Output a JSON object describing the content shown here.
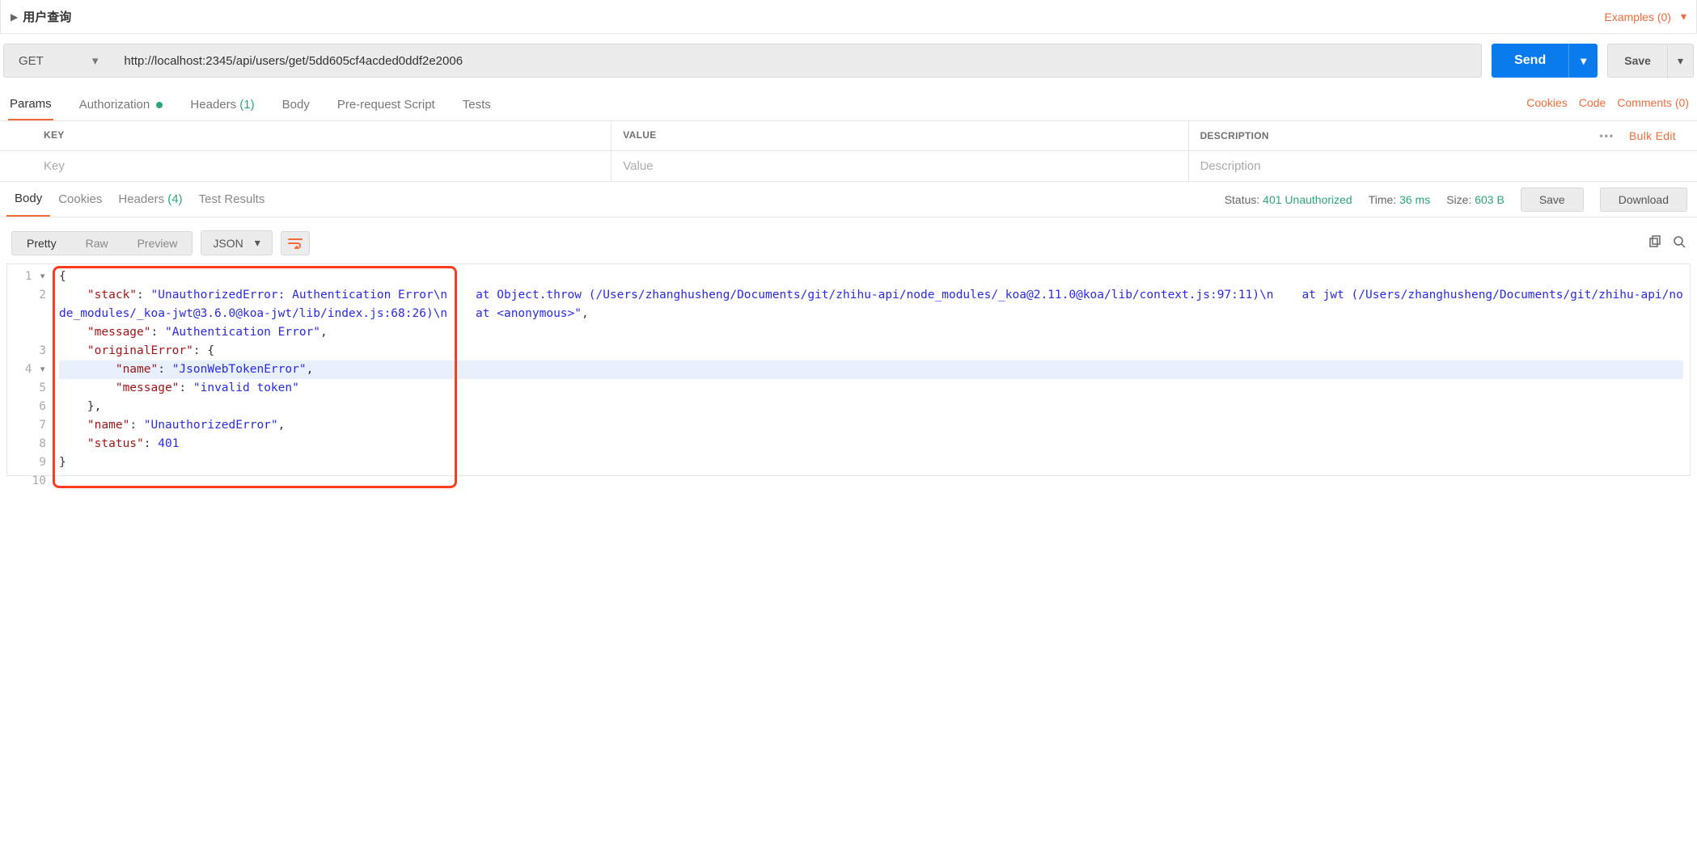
{
  "topbar": {
    "title": "用户查询",
    "examples": "Examples (0)"
  },
  "request": {
    "method": "GET",
    "url": "http://localhost:2345/api/users/get/5dd605cf4acded0ddf2e2006",
    "send": "Send",
    "save": "Save"
  },
  "reqtabs": {
    "params": "Params",
    "authorization": "Authorization",
    "headers": "Headers",
    "headers_count": "(1)",
    "body": "Body",
    "prerequest": "Pre-request Script",
    "tests": "Tests",
    "cookies": "Cookies",
    "code": "Code",
    "comments": "Comments (0)"
  },
  "params_header": {
    "key": "KEY",
    "value": "VALUE",
    "description": "DESCRIPTION",
    "bulk": "Bulk Edit"
  },
  "params_row": {
    "key_ph": "Key",
    "value_ph": "Value",
    "desc_ph": "Description"
  },
  "resp_tabs": {
    "body": "Body",
    "cookies": "Cookies",
    "headers": "Headers",
    "headers_count": "(4)",
    "tests": "Test Results"
  },
  "status": {
    "status_lbl": "Status:",
    "status_val": "401 Unauthorized",
    "time_lbl": "Time:",
    "time_val": "36 ms",
    "size_lbl": "Size:",
    "size_val": "603 B",
    "save": "Save",
    "download": "Download"
  },
  "fmt": {
    "pretty": "Pretty",
    "raw": "Raw",
    "preview": "Preview",
    "json": "JSON"
  },
  "code_lines": [
    "1",
    "2",
    "3",
    "4",
    "5",
    "6",
    "7",
    "8",
    "9",
    "10"
  ],
  "response_body": {
    "stack": "UnauthorizedError: Authentication Error\\n    at Object.throw (/Users/zhanghusheng/Documents/git/zhihu-api/node_modules/_koa@2.11.0@koa/lib/context.js:97:11)\\n    at jwt (/Users/zhanghusheng/Documents/git/zhihu-api/node_modules/_koa-jwt@3.6.0@koa-jwt/lib/index.js:68:26)\\n    at <anonymous>",
    "message": "Authentication Error",
    "originalError": {
      "name": "JsonWebTokenError",
      "message": "invalid token"
    },
    "name": "UnauthorizedError",
    "status": 401
  }
}
